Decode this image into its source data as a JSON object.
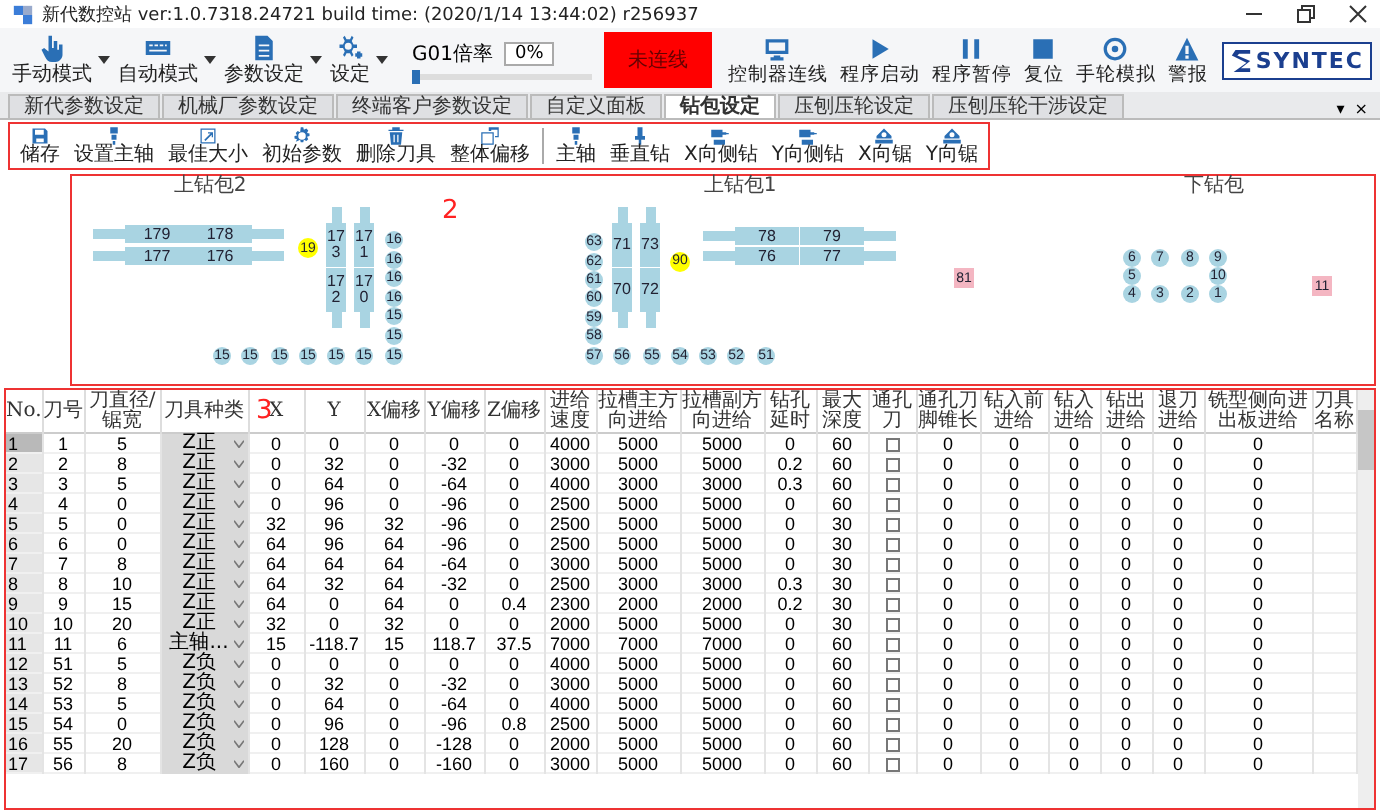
{
  "window": {
    "title": "新代数控站 ver:1.0.7318.24721 build time: (2020/1/14 13:44:02) r256937"
  },
  "modes": [
    {
      "label": "手动模式"
    },
    {
      "label": "自动模式"
    },
    {
      "label": "参数设定"
    },
    {
      "label": "设定"
    }
  ],
  "override": {
    "label": "G01倍率",
    "reading": "0%",
    "level": 0
  },
  "status": {
    "label": "未连线",
    "connected": false
  },
  "actions": [
    {
      "label": "控制器连线"
    },
    {
      "label": "程序启动"
    },
    {
      "label": "程序暂停"
    },
    {
      "label": "复位"
    },
    {
      "label": "手轮模拟"
    },
    {
      "label": "警报"
    }
  ],
  "logo": "SYNTEC",
  "tabs": [
    {
      "label": "新代参数设定",
      "selected": false
    },
    {
      "label": "机械厂参数设定",
      "selected": false
    },
    {
      "label": "终端客户参数设定",
      "selected": false
    },
    {
      "label": "自定义面板",
      "selected": false
    },
    {
      "label": "钻包设定",
      "selected": true
    },
    {
      "label": "压刨压轮设定",
      "selected": false
    },
    {
      "label": "压刨压轮干涉设定",
      "selected": false
    }
  ],
  "pane_controls": [
    "▾",
    "×"
  ],
  "tool_groups": [
    [
      {
        "label": "储存"
      },
      {
        "label": "设置主轴"
      },
      {
        "label": "最佳大小"
      },
      {
        "label": "初始参数"
      },
      {
        "label": "删除刀具"
      },
      {
        "label": "整体偏移"
      }
    ],
    [
      {
        "label": "主轴"
      },
      {
        "label": "垂直钻"
      },
      {
        "label": "X向侧钻"
      },
      {
        "label": "Y向侧钻"
      },
      {
        "label": "X向锯"
      },
      {
        "label": "Y向锯"
      }
    ]
  ],
  "diagram": {
    "annotation": "2",
    "heads": [
      {
        "label": "上钻包2"
      },
      {
        "label": "上钻包1"
      },
      {
        "label": "下钻包"
      }
    ],
    "spindles": [
      {
        "label": "179",
        "kind": "hleft"
      },
      {
        "label": "178",
        "kind": "hright"
      },
      {
        "label": "177",
        "kind": "hleft"
      },
      {
        "label": "176",
        "kind": "hright"
      },
      {
        "label": "19",
        "kind": "marker"
      },
      {
        "label": "173",
        "kind": "vtop"
      },
      {
        "label": "172",
        "kind": "vbottom"
      },
      {
        "label": "171",
        "kind": "vtop"
      },
      {
        "label": "170",
        "kind": "vbottom"
      },
      {
        "label": "16",
        "kind": "circle"
      },
      {
        "label": "16",
        "kind": "circle"
      },
      {
        "label": "16",
        "kind": "circle"
      },
      {
        "label": "16",
        "kind": "circle"
      },
      {
        "label": "15",
        "kind": "circle"
      },
      {
        "label": "15",
        "kind": "circle"
      },
      {
        "label": "15",
        "kind": "circle"
      },
      {
        "label": "15",
        "kind": "circle"
      },
      {
        "label": "15",
        "kind": "circle"
      },
      {
        "label": "15",
        "kind": "circle"
      },
      {
        "label": "15",
        "kind": "circle"
      },
      {
        "label": "15",
        "kind": "circle"
      },
      {
        "label": "15",
        "kind": "circle"
      },
      {
        "label": "63",
        "kind": "circle"
      },
      {
        "label": "62",
        "kind": "circle"
      },
      {
        "label": "61",
        "kind": "circle"
      },
      {
        "label": "60",
        "kind": "circle"
      },
      {
        "label": "59",
        "kind": "circle"
      },
      {
        "label": "58",
        "kind": "circle"
      },
      {
        "label": "57",
        "kind": "circle"
      },
      {
        "label": "56",
        "kind": "circle"
      },
      {
        "label": "55",
        "kind": "circle"
      },
      {
        "label": "54",
        "kind": "circle"
      },
      {
        "label": "53",
        "kind": "circle"
      },
      {
        "label": "52",
        "kind": "circle"
      },
      {
        "label": "51",
        "kind": "circle"
      },
      {
        "label": "71",
        "kind": "vtop"
      },
      {
        "label": "70",
        "kind": "vbottom"
      },
      {
        "label": "73",
        "kind": "vtop"
      },
      {
        "label": "72",
        "kind": "vbottom"
      },
      {
        "label": "90",
        "kind": "marker"
      },
      {
        "label": "78",
        "kind": "hleft"
      },
      {
        "label": "79",
        "kind": "hright"
      },
      {
        "label": "76",
        "kind": "hleft"
      },
      {
        "label": "77",
        "kind": "hright"
      },
      {
        "label": "81",
        "kind": "square"
      },
      {
        "label": "6",
        "kind": "circle"
      },
      {
        "label": "7",
        "kind": "circle"
      },
      {
        "label": "8",
        "kind": "circle"
      },
      {
        "label": "9",
        "kind": "circle"
      },
      {
        "label": "5",
        "kind": "circle"
      },
      {
        "label": "10",
        "kind": "circle"
      },
      {
        "label": "4",
        "kind": "circle"
      },
      {
        "label": "3",
        "kind": "circle"
      },
      {
        "label": "2",
        "kind": "circle"
      },
      {
        "label": "1",
        "kind": "circle"
      },
      {
        "label": "11",
        "kind": "square"
      }
    ]
  },
  "table": {
    "annotation": "3",
    "columns": [
      "No.",
      "刀号",
      "刀直径/锯宽",
      "刀具种类",
      "X",
      "Y",
      "X偏移",
      "Y偏移",
      "Z偏移",
      "进给速度",
      "拉槽主方向进给",
      "拉槽副方向进给",
      "钻孔延时",
      "最大深度",
      "通孔刀",
      "通孔刀脚锥长",
      "钻入前进给",
      "钻入进给",
      "钻出进给",
      "退刀进给",
      "铣型侧向进出板进给",
      "刀具名称"
    ],
    "rows": [
      {
        "selected": true,
        "cells": [
          "1",
          "1",
          "5"
        ],
        "type": "Z正",
        "values": [
          "0",
          "0",
          "0",
          "0",
          "0",
          "4000",
          "5000",
          "5000",
          "0",
          "60"
        ],
        "through": false,
        "tail": [
          "0",
          "0",
          "0",
          "0",
          "0",
          "0"
        ]
      },
      {
        "selected": false,
        "cells": [
          "2",
          "2",
          "8"
        ],
        "type": "Z正",
        "values": [
          "0",
          "32",
          "0",
          "-32",
          "0",
          "3000",
          "5000",
          "5000",
          "0.2",
          "60"
        ],
        "through": false,
        "tail": [
          "0",
          "0",
          "0",
          "0",
          "0",
          "0"
        ]
      },
      {
        "selected": false,
        "cells": [
          "3",
          "3",
          "5"
        ],
        "type": "Z正",
        "values": [
          "0",
          "64",
          "0",
          "-64",
          "0",
          "4000",
          "3000",
          "3000",
          "0.3",
          "60"
        ],
        "through": false,
        "tail": [
          "0",
          "0",
          "0",
          "0",
          "0",
          "0"
        ]
      },
      {
        "selected": false,
        "cells": [
          "4",
          "4",
          "0"
        ],
        "type": "Z正",
        "values": [
          "0",
          "96",
          "0",
          "-96",
          "0",
          "2500",
          "5000",
          "5000",
          "0",
          "60"
        ],
        "through": false,
        "tail": [
          "0",
          "0",
          "0",
          "0",
          "0",
          "0"
        ]
      },
      {
        "selected": false,
        "cells": [
          "5",
          "5",
          "0"
        ],
        "type": "Z正",
        "values": [
          "32",
          "96",
          "32",
          "-96",
          "0",
          "2500",
          "5000",
          "5000",
          "0",
          "30"
        ],
        "through": false,
        "tail": [
          "0",
          "0",
          "0",
          "0",
          "0",
          "0"
        ]
      },
      {
        "selected": false,
        "cells": [
          "6",
          "6",
          "0"
        ],
        "type": "Z正",
        "values": [
          "64",
          "96",
          "64",
          "-96",
          "0",
          "2500",
          "5000",
          "5000",
          "0",
          "30"
        ],
        "through": false,
        "tail": [
          "0",
          "0",
          "0",
          "0",
          "0",
          "0"
        ]
      },
      {
        "selected": false,
        "cells": [
          "7",
          "7",
          "8"
        ],
        "type": "Z正",
        "values": [
          "64",
          "64",
          "64",
          "-64",
          "0",
          "3000",
          "5000",
          "5000",
          "0",
          "30"
        ],
        "through": false,
        "tail": [
          "0",
          "0",
          "0",
          "0",
          "0",
          "0"
        ]
      },
      {
        "selected": false,
        "cells": [
          "8",
          "8",
          "10"
        ],
        "type": "Z正",
        "values": [
          "64",
          "32",
          "64",
          "-32",
          "0",
          "2500",
          "3000",
          "3000",
          "0.3",
          "30"
        ],
        "through": false,
        "tail": [
          "0",
          "0",
          "0",
          "0",
          "0",
          "0"
        ]
      },
      {
        "selected": false,
        "cells": [
          "9",
          "9",
          "15"
        ],
        "type": "Z正",
        "values": [
          "64",
          "0",
          "64",
          "0",
          "0.4",
          "2300",
          "2000",
          "2000",
          "0.2",
          "30"
        ],
        "through": false,
        "tail": [
          "0",
          "0",
          "0",
          "0",
          "0",
          "0"
        ]
      },
      {
        "selected": false,
        "cells": [
          "10",
          "10",
          "20"
        ],
        "type": "Z正",
        "values": [
          "32",
          "0",
          "32",
          "0",
          "0",
          "2000",
          "5000",
          "5000",
          "0",
          "30"
        ],
        "through": false,
        "tail": [
          "0",
          "0",
          "0",
          "0",
          "0",
          "0"
        ]
      },
      {
        "selected": false,
        "cells": [
          "11",
          "11",
          "6"
        ],
        "type": "主轴...",
        "values": [
          "15",
          "-118.7",
          "15",
          "118.7",
          "37.5",
          "7000",
          "7000",
          "7000",
          "0",
          "60"
        ],
        "through": false,
        "tail": [
          "0",
          "0",
          "0",
          "0",
          "0",
          "0"
        ]
      },
      {
        "selected": false,
        "cells": [
          "12",
          "51",
          "5"
        ],
        "type": "Z负",
        "values": [
          "0",
          "0",
          "0",
          "0",
          "0",
          "4000",
          "5000",
          "5000",
          "0",
          "60"
        ],
        "through": false,
        "tail": [
          "0",
          "0",
          "0",
          "0",
          "0",
          "0"
        ]
      },
      {
        "selected": false,
        "cells": [
          "13",
          "52",
          "8"
        ],
        "type": "Z负",
        "values": [
          "0",
          "32",
          "0",
          "-32",
          "0",
          "3000",
          "5000",
          "5000",
          "0",
          "60"
        ],
        "through": false,
        "tail": [
          "0",
          "0",
          "0",
          "0",
          "0",
          "0"
        ]
      },
      {
        "selected": false,
        "cells": [
          "14",
          "53",
          "5"
        ],
        "type": "Z负",
        "values": [
          "0",
          "64",
          "0",
          "-64",
          "0",
          "4000",
          "5000",
          "5000",
          "0",
          "60"
        ],
        "through": false,
        "tail": [
          "0",
          "0",
          "0",
          "0",
          "0",
          "0"
        ]
      },
      {
        "selected": false,
        "cells": [
          "15",
          "54",
          "0"
        ],
        "type": "Z负",
        "values": [
          "0",
          "96",
          "0",
          "-96",
          "0.8",
          "2500",
          "5000",
          "5000",
          "0",
          "60"
        ],
        "through": false,
        "tail": [
          "0",
          "0",
          "0",
          "0",
          "0",
          "0"
        ]
      },
      {
        "selected": false,
        "cells": [
          "16",
          "55",
          "20"
        ],
        "type": "Z负",
        "values": [
          "0",
          "128",
          "0",
          "-128",
          "0",
          "2000",
          "5000",
          "5000",
          "0",
          "60"
        ],
        "through": false,
        "tail": [
          "0",
          "0",
          "0",
          "0",
          "0",
          "0"
        ]
      },
      {
        "selected": false,
        "cells": [
          "17",
          "56",
          "8"
        ],
        "type": "Z负",
        "values": [
          "0",
          "160",
          "0",
          "-160",
          "0",
          "3000",
          "5000",
          "5000",
          "0",
          "60"
        ],
        "through": false,
        "tail": [
          "0",
          "0",
          "0",
          "0",
          "0",
          "0"
        ]
      }
    ]
  }
}
